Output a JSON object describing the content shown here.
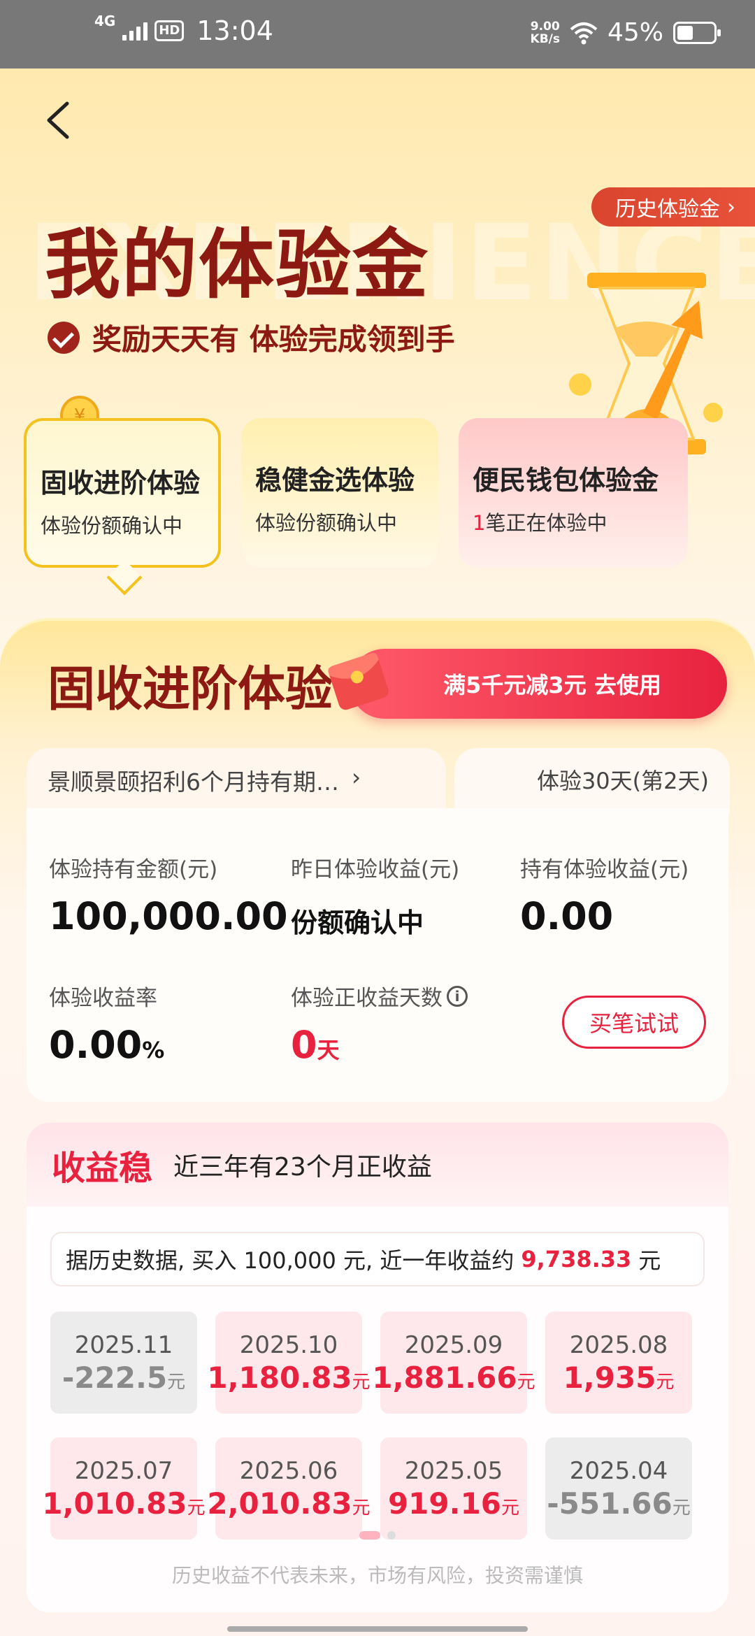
{
  "status_bar": {
    "network": "4G",
    "hd": "HD",
    "time": "13:04",
    "speed_value": "9.00",
    "speed_unit": "KB/s",
    "battery": "45%"
  },
  "header": {
    "history_label": "历史体验金",
    "watermark": "EXPERIENCE GOLD",
    "title": "我的体验金",
    "subtitle": "奖励天天有 体验完成领到手"
  },
  "tabs": [
    {
      "title": "固收进阶体验",
      "sub": "体验份额确认中"
    },
    {
      "title": "稳健金选体验",
      "sub": "体验份额确认中"
    },
    {
      "title": "便民钱包体验金",
      "sub_count": "1",
      "sub": "笔正在体验中"
    }
  ],
  "card": {
    "title": "固收进阶体验",
    "coupon": "满5千元减3元 去使用",
    "fund_name": "景顺景颐招利6个月持有期…",
    "days": "体验30天(第2天)",
    "stats": {
      "hold_amount_label": "体验持有金额(元)",
      "hold_amount": "100,000.00",
      "yesterday_label": "昨日体验收益(元)",
      "yesterday": "份额确认中",
      "hold_income_label": "持有体验收益(元)",
      "hold_income": "0.00",
      "rate_label": "体验收益率",
      "rate": "0.00",
      "rate_unit": "%",
      "positive_days_label": "体验正收益天数",
      "positive_days": "0",
      "positive_days_unit": "天",
      "buy_label": "买笔试试"
    }
  },
  "earnings": {
    "tag": "收益稳",
    "desc": "近三年有23个月正收益",
    "note_prefix": "据历史数据, 买入 100,000 元, 近一年收益约",
    "note_value": "9,738.33",
    "note_suffix": "元",
    "unit": "元",
    "months": [
      {
        "date": "2025.11",
        "value": "-222.5",
        "sign": "neg"
      },
      {
        "date": "2025.10",
        "value": "1,180.83",
        "sign": "pos"
      },
      {
        "date": "2025.09",
        "value": "1,881.66",
        "sign": "pos"
      },
      {
        "date": "2025.08",
        "value": "1,935",
        "sign": "pos"
      },
      {
        "date": "2025.07",
        "value": "1,010.83",
        "sign": "pos"
      },
      {
        "date": "2025.06",
        "value": "2,010.83",
        "sign": "pos"
      },
      {
        "date": "2025.05",
        "value": "919.16",
        "sign": "pos"
      },
      {
        "date": "2025.04",
        "value": "-551.66",
        "sign": "neg"
      }
    ],
    "disclaimer": "历史收益不代表未来，市场有风险，投资需谨慎"
  },
  "colors": {
    "accent_red": "#e8223e",
    "title_brown": "#8c1a12",
    "tab_highlight": "#f4c21e"
  }
}
